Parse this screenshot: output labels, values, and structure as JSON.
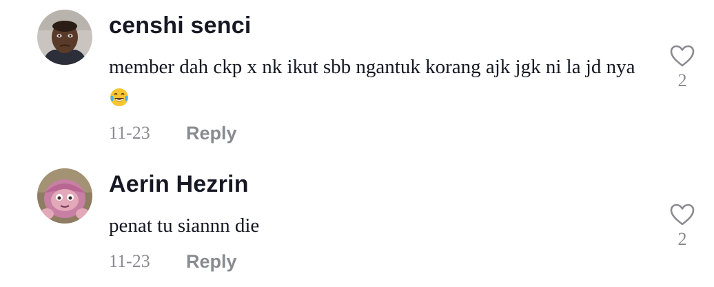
{
  "comments": [
    {
      "username": "censhi senci",
      "text": "member dah ckp x nk ikut sbb ngantuk korang ajk jgk ni la jd nya",
      "emoji": "😂",
      "date": "11-23",
      "reply_label": "Reply",
      "likes": "2",
      "avatar_icon": "avatar-man-photo",
      "like_icon": "heart-outline-icon"
    },
    {
      "username": "Aerin Hezrin",
      "text": "penat tu siannn die",
      "date": "11-23",
      "reply_label": "Reply",
      "likes": "2",
      "avatar_icon": "avatar-pink-character-photo",
      "like_icon": "heart-outline-icon"
    }
  ],
  "colors": {
    "text_primary": "#161823",
    "text_secondary": "#8a8b91",
    "background": "#ffffff"
  }
}
